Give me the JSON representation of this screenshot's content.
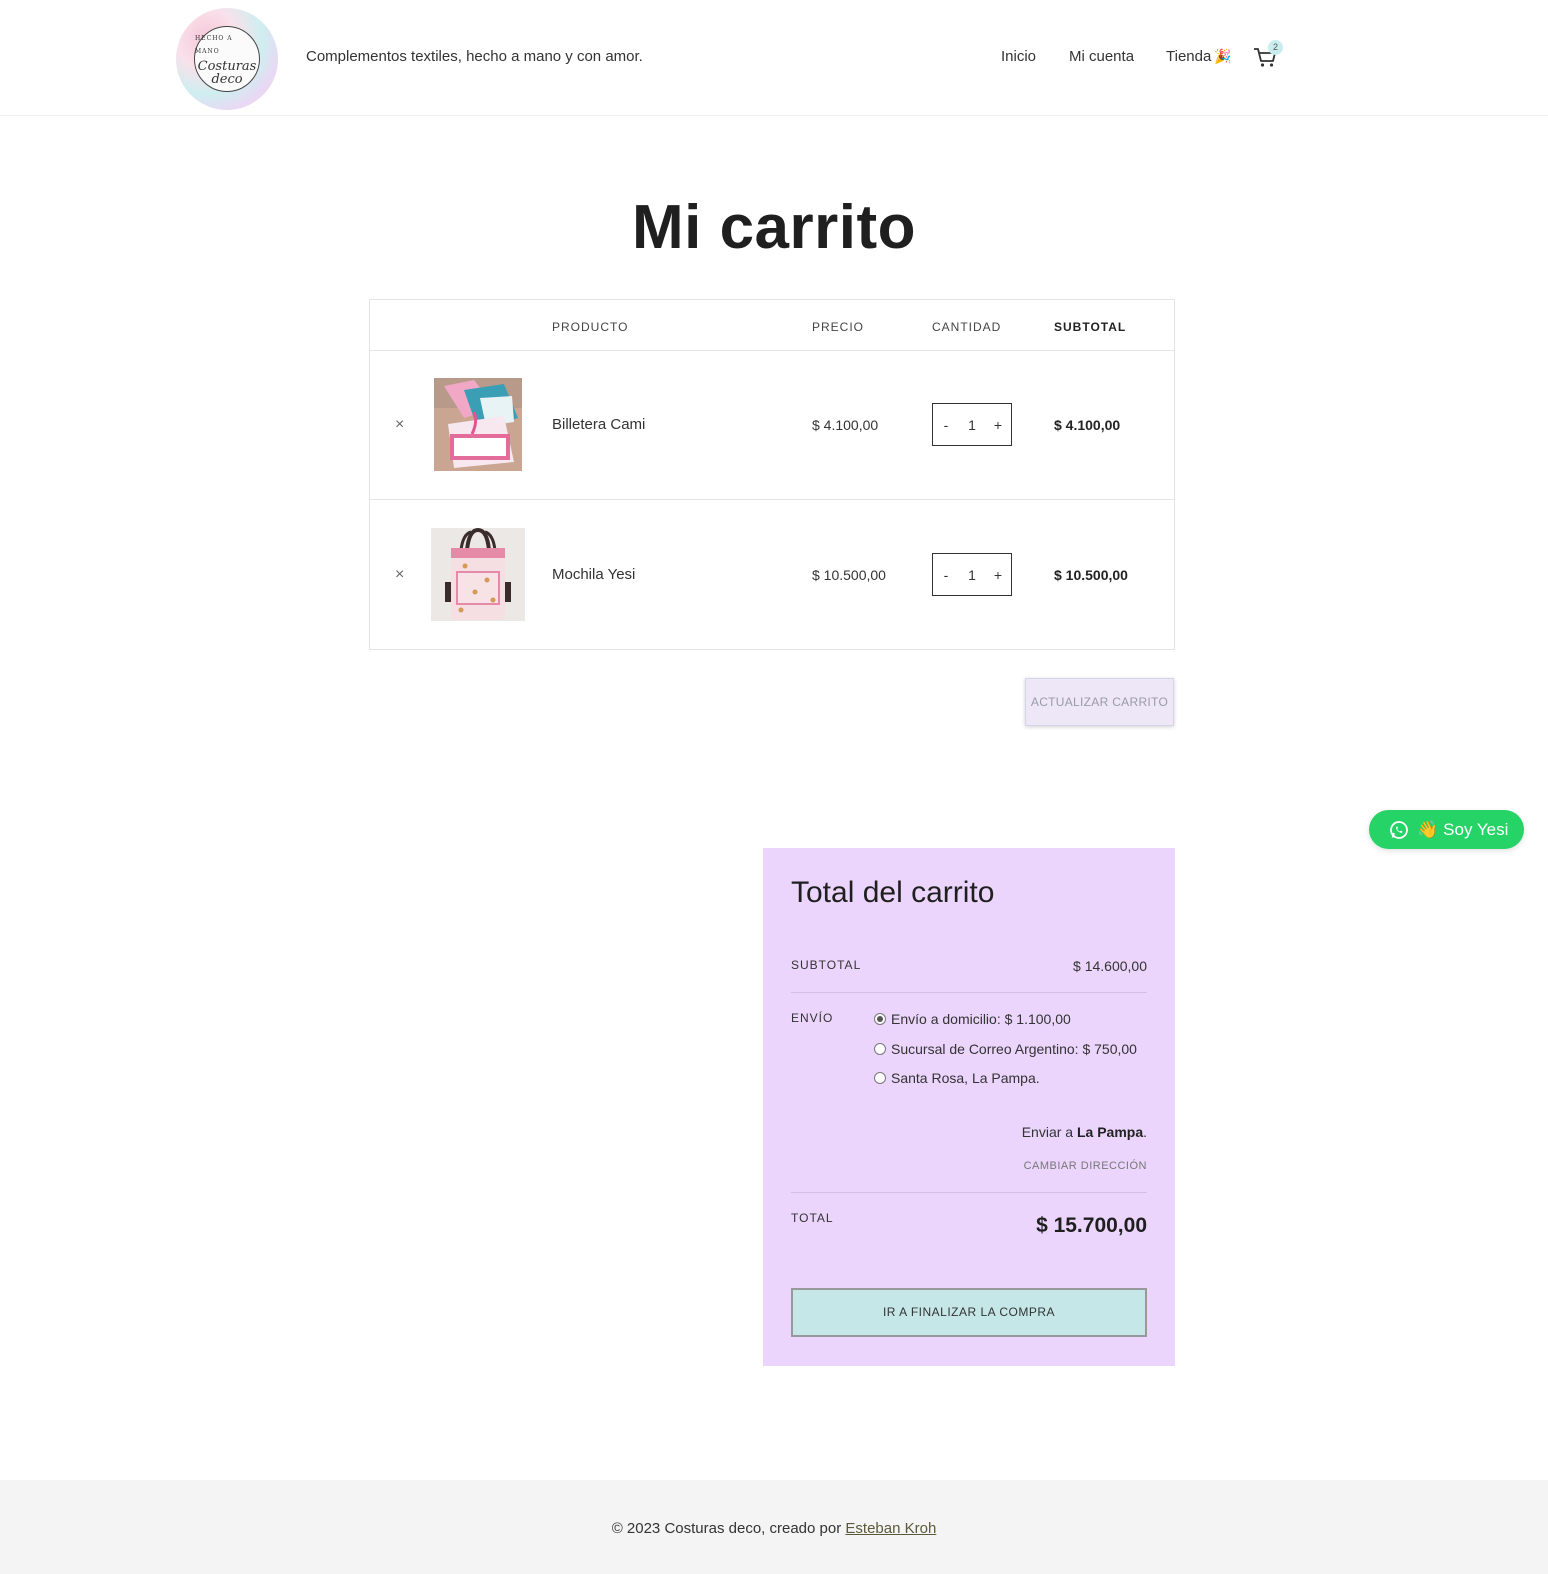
{
  "header": {
    "tagline": "Complementos textiles, hecho a mano y con amor.",
    "logo_text_1": "Costuras",
    "logo_text_2": "deco",
    "logo_top_text": "HECHO A MANO",
    "nav": {
      "inicio": "Inicio",
      "mi_cuenta": "Mi cuenta",
      "tienda": "Tienda",
      "tienda_emoji": "🎉"
    },
    "cart_count": "2"
  },
  "page_title": "Mi carrito",
  "cart": {
    "columns": {
      "producto": "PRODUCTO",
      "precio": "PRECIO",
      "cantidad": "CANTIDAD",
      "subtotal": "SUBTOTAL"
    },
    "items": [
      {
        "remove": "×",
        "name": "Billetera Cami",
        "price": "$ 4.100,00",
        "qty_minus": "-",
        "qty": "1",
        "qty_plus": "+",
        "subtotal": "$ 4.100,00"
      },
      {
        "remove": "×",
        "name": "Mochila Yesi",
        "price": "$ 10.500,00",
        "qty_minus": "-",
        "qty": "1",
        "qty_plus": "+",
        "subtotal": "$ 10.500,00"
      }
    ],
    "update_button": "ACTUALIZAR CARRITO"
  },
  "whatsapp": {
    "wave": "👋",
    "label": "Soy Yesi",
    "color": "#25d366"
  },
  "totals": {
    "title": "Total del carrito",
    "subtotal_label": "SUBTOTAL",
    "subtotal_value": "$ 14.600,00",
    "shipping_label": "ENVÍO",
    "shipping_options": [
      {
        "label": "Envío a domicilio: $ 1.100,00",
        "selected": true
      },
      {
        "label": "Sucursal de Correo Argentino: $ 750,00",
        "selected": false
      },
      {
        "label": "Santa Rosa, La Pampa.",
        "selected": false
      }
    ],
    "ship_to_prefix": "Enviar a",
    "ship_to_place": "La Pampa",
    "ship_to_suffix": ".",
    "change_address": "CAMBIAR DIRECCIÓN",
    "total_label": "TOTAL",
    "total_value": "$ 15.700,00",
    "checkout_button": "IR A FINALIZAR LA COMPRA",
    "background": "#ecd5fc"
  },
  "footer": {
    "text": "© 2023 Costuras deco, creado por",
    "link": "Esteban Kroh"
  }
}
